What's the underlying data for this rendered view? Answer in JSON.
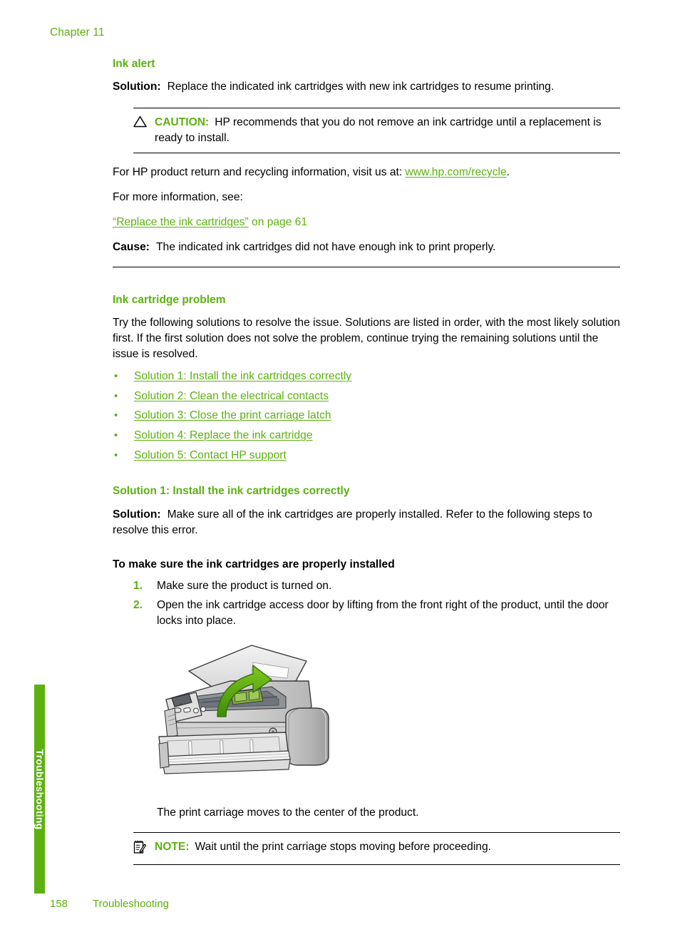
{
  "page": {
    "chapter": "Chapter 11",
    "footer_page_number": "158",
    "footer_section": "Troubleshooting",
    "side_tab_label": "Troubleshooting",
    "accent_green": "#5cb111",
    "text_black": "#000000"
  },
  "ink_alert": {
    "heading": "Ink alert",
    "solution_label": "Solution:",
    "solution_text": "Replace the indicated ink cartridges with new ink cartridges to resume printing.",
    "caution": {
      "icon": "warning-triangle-icon",
      "keyword": "CAUTION:",
      "text": "HP recommends that you do not remove an ink cartridge until a replacement is ready to install."
    },
    "recycle_line_before": "For HP product return and recycling information, visit us at: ",
    "recycle_link": "www.hp.com/recycle",
    "recycle_line_after": ".",
    "more_info": "For more information, see:",
    "xref_quoted": "“Replace the ink cartridges”",
    "xref_page": " on page 61",
    "cause_label": "Cause:",
    "cause_text": "The indicated ink cartridges did not have enough ink to print properly."
  },
  "ink_cartridge_problem": {
    "heading": "Ink cartridge problem",
    "intro": "Try the following solutions to resolve the issue. Solutions are listed in order, with the most likely solution first. If the first solution does not solve the problem, continue trying the remaining solutions until the issue is resolved.",
    "links": [
      "Solution 1: Install the ink cartridges correctly",
      "Solution 2: Clean the electrical contacts",
      "Solution 3: Close the print carriage latch",
      "Solution 4: Replace the ink cartridge",
      "Solution 5: Contact HP support"
    ]
  },
  "solution_1": {
    "heading": "Solution 1: Install the ink cartridges correctly",
    "solution_label": "Solution:",
    "solution_text": "Make sure all of the ink cartridges are properly installed. Refer to the following steps to resolve this error.",
    "procedure_title": "To make sure the ink cartridges are properly installed",
    "steps": [
      {
        "num": "1.",
        "text": "Make sure the product is turned on."
      },
      {
        "num": "2.",
        "text": "Open the ink cartridge access door by lifting from the front right of the product, until the door locks into place."
      }
    ],
    "illustration_alt": "all-in-one-printer-open-lid-illustration",
    "after_illustration": "The print carriage moves to the center of the product.",
    "note": {
      "icon": "notepad-pencil-icon",
      "keyword": "NOTE:",
      "text": "Wait until the print carriage stops moving before proceeding."
    }
  }
}
